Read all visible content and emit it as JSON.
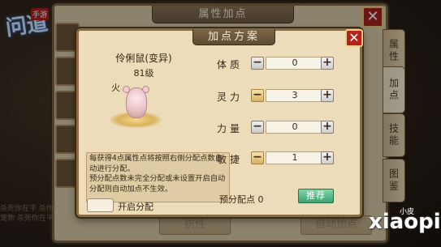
{
  "game": {
    "logo_text": "问道",
    "logo_tag": "手游"
  },
  "outer_panel": {
    "title": "属性加点",
    "close_label": "✕",
    "side_tabs": [
      "属性",
      "加点",
      "技能",
      "图鉴"
    ],
    "bottom_buttons": [
      "抗性",
      "自动加点"
    ],
    "left_text": "杀死你在平 杀你的宠物 杀死你在平"
  },
  "modal": {
    "title": "加点方案",
    "close_label": "✕",
    "pet": {
      "name": "伶俐鼠(变异)",
      "level": "81级",
      "element": "火"
    },
    "description": "每获得4点属性点将按照右侧分配点数自动进行分配。\n预分配点数未完全分配或未设置开启自动分配则自动加点不生效。",
    "auto_toggle_label": "开启分配",
    "stats": [
      {
        "label": "体质",
        "value": "0",
        "minus_active": false
      },
      {
        "label": "灵力",
        "value": "3",
        "minus_active": true
      },
      {
        "label": "力量",
        "value": "0",
        "minus_active": false
      },
      {
        "label": "敏捷",
        "value": "1",
        "minus_active": true
      }
    ],
    "minus_symbol": "−",
    "plus_symbol": "+",
    "remaining_label": "预分配点 0",
    "recommend_label": "推荐"
  },
  "watermark": {
    "text": "xiaopi",
    "small": "小皮"
  },
  "colors": {
    "panel_bg": "#ecdcb9",
    "header_bg": "#6e5a40",
    "close_red": "#b5221c",
    "recommend_green": "#3e9f6e"
  }
}
